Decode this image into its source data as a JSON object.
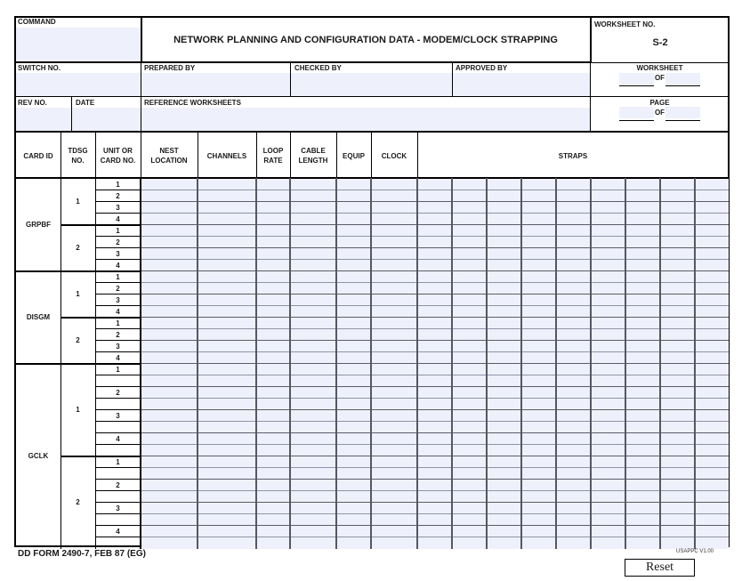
{
  "header": {
    "command_label": "COMMAND",
    "title": "NETWORK PLANNING AND CONFIGURATION DATA - MODEM/CLOCK  STRAPPING",
    "worksheet_no_label": "WORKSHEET NO.",
    "worksheet_no_value": "S-2",
    "switch_no_label": "SWITCH NO.",
    "prepared_by_label": "PREPARED BY",
    "checked_by_label": "CHECKED BY",
    "approved_by_label": "APPROVED BY",
    "worksheet_label": "WORKSHEET",
    "worksheet_of_label": "OF",
    "rev_no_label": "REV NO.",
    "date_label": "DATE",
    "reference_worksheets_label": "REFERENCE WORKSHEETS",
    "page_label": "PAGE",
    "page_of_label": "OF"
  },
  "table": {
    "columns": {
      "card_id": "CARD ID",
      "tdsg_no": "TDSG NO.",
      "unit_or_card_no": "UNIT OR CARD NO.",
      "nest_location": "NEST LOCATION",
      "channels": "CHANNELS",
      "loop_rate": "LOOP RATE",
      "cable_length": "CABLE LENGTH",
      "equip": "EQUIP",
      "clock": "CLOCK",
      "straps": "STRAPS"
    },
    "groups": [
      {
        "card_id": "GRPBF",
        "tdsg": [
          {
            "no": "1",
            "units": [
              "1",
              "2",
              "3",
              "4"
            ]
          },
          {
            "no": "2",
            "units": [
              "1",
              "2",
              "3",
              "4"
            ]
          }
        ]
      },
      {
        "card_id": "DISGM",
        "tdsg": [
          {
            "no": "1",
            "units": [
              "1",
              "2",
              "3",
              "4"
            ]
          },
          {
            "no": "2",
            "units": [
              "1",
              "2",
              "3",
              "4"
            ]
          }
        ]
      },
      {
        "card_id": "GCLK",
        "tdsg": [
          {
            "no": "1",
            "units": [
              "1",
              "",
              "2",
              "",
              "3",
              "",
              "4",
              ""
            ]
          },
          {
            "no": "2",
            "units": [
              "1",
              "",
              "2",
              "",
              "3",
              "",
              "4",
              ""
            ]
          }
        ]
      }
    ]
  },
  "footer": {
    "form_id": "DD FORM 2490-7, FEB 87 (EG)",
    "version": "USAPPC V1.00",
    "reset_label": "Reset"
  }
}
